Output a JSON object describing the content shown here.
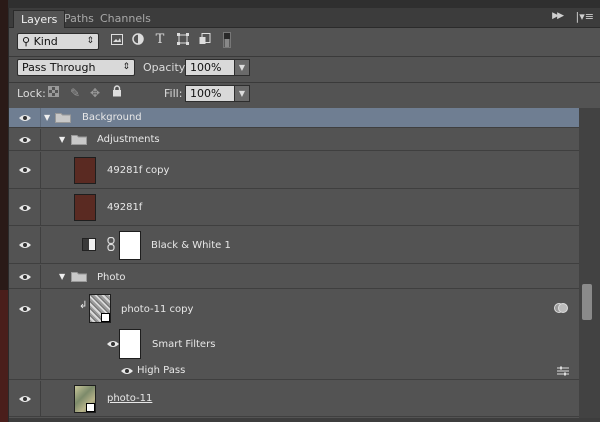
{
  "tabs": [
    {
      "label": "Layers",
      "active": true
    },
    {
      "label": "Paths",
      "active": false
    },
    {
      "label": "Channels",
      "active": false
    }
  ],
  "filter": {
    "kind_label": "Kind",
    "icons": [
      "image-filter-icon",
      "adjustment-filter-icon",
      "type-filter-icon",
      "shape-filter-icon",
      "smart-object-filter-icon",
      "filter-toggle-icon"
    ]
  },
  "blend": {
    "mode": "Pass Through",
    "opacity_label": "Opacity:",
    "opacity_value": "100%",
    "lock_label": "Lock:",
    "fill_label": "Fill:",
    "fill_value": "100%"
  },
  "layers": [
    {
      "name": "Background",
      "type": "group",
      "selected": true
    },
    {
      "name": "Adjustments",
      "type": "group"
    },
    {
      "name": "49281f copy",
      "type": "fill",
      "color": "#5a2a22"
    },
    {
      "name": "49281f",
      "type": "fill",
      "color": "#5a2a22"
    },
    {
      "name": "Black & White 1",
      "type": "adjustment"
    },
    {
      "name": "Photo",
      "type": "group"
    },
    {
      "name": "photo-11 copy",
      "type": "smart-object"
    },
    {
      "name": "Smart Filters",
      "type": "smart-filters"
    },
    {
      "name": "High Pass",
      "type": "filter"
    },
    {
      "name": "photo-11",
      "type": "smart-object"
    }
  ],
  "colors": {
    "panel_bg": "#535353",
    "selected_row": "#6f7e92",
    "swatch": "#5a2a22"
  }
}
